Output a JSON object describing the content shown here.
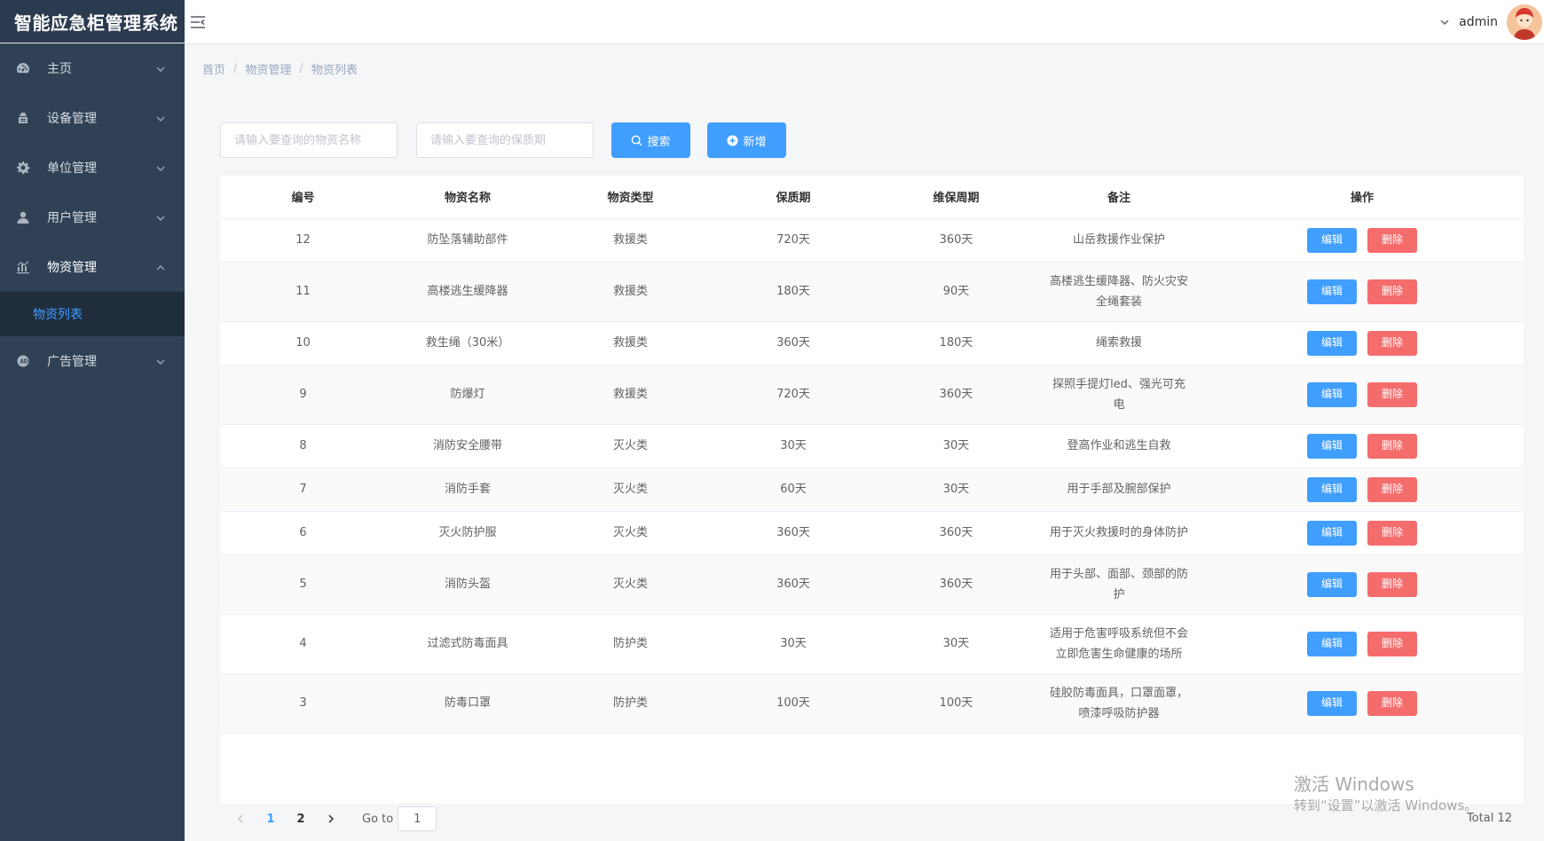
{
  "app": {
    "title": "智能应急柜管理系统"
  },
  "sidebar": {
    "items": [
      {
        "label": "主页",
        "icon": "dashboard-icon"
      },
      {
        "label": "设备管理",
        "icon": "device-icon"
      },
      {
        "label": "单位管理",
        "icon": "gear-icon"
      },
      {
        "label": "用户管理",
        "icon": "user-icon"
      },
      {
        "label": "物资管理",
        "icon": "chart-icon",
        "open": true
      },
      {
        "label": "广告管理",
        "icon": "ad-icon"
      }
    ],
    "submenu": [
      {
        "label": "物资列表",
        "active": true
      }
    ]
  },
  "header": {
    "user": "admin"
  },
  "breadcrumb": [
    "首页",
    "物资管理",
    "物资列表"
  ],
  "toolbar": {
    "name_placeholder": "请输入要查询的物资名称",
    "period_placeholder": "请输入要查询的保质期",
    "search_label": "搜索",
    "add_label": "新增"
  },
  "table": {
    "columns": [
      "编号",
      "物资名称",
      "物资类型",
      "保质期",
      "维保周期",
      "备注",
      "操作"
    ],
    "edit_label": "编辑",
    "delete_label": "删除",
    "rows": [
      [
        "12",
        "防坠落辅助部件",
        "救援类",
        "720天",
        "360天",
        "山岳救援作业保护"
      ],
      [
        "11",
        "高楼逃生缓降器",
        "救援类",
        "180天",
        "90天",
        "高楼逃生缓降器、防火灾安全绳套装"
      ],
      [
        "10",
        "救生绳（30米）",
        "救援类",
        "360天",
        "180天",
        "绳索救援"
      ],
      [
        "9",
        "防爆灯",
        "救援类",
        "720天",
        "360天",
        "探照手提灯led、强光可充电"
      ],
      [
        "8",
        "消防安全腰带",
        "灭火类",
        "30天",
        "30天",
        "登高作业和逃生自救"
      ],
      [
        "7",
        "消防手套",
        "灭火类",
        "60天",
        "30天",
        "用于手部及腕部保护"
      ],
      [
        "6",
        "灭火防护服",
        "灭火类",
        "360天",
        "360天",
        "用于灭火救援时的身体防护"
      ],
      [
        "5",
        "消防头盔",
        "灭火类",
        "360天",
        "360天",
        "用于头部、面部、颈部的防护"
      ],
      [
        "4",
        "过滤式防毒面具",
        "防护类",
        "30天",
        "30天",
        "适用于危害呼吸系统但不会立即危害生命健康的场所"
      ],
      [
        "3",
        "防毒口罩",
        "防护类",
        "100天",
        "100天",
        "硅胶防毒面具，口罩面罩，喷漆呼吸防护器"
      ]
    ]
  },
  "pagination": {
    "pages": [
      "1",
      "2"
    ],
    "current": "1",
    "goto_label": "Go to",
    "goto_value": "1",
    "total": "Total 12"
  },
  "watermark": {
    "line1": "激活 Windows",
    "line2": "转到“设置”以激活 Windows。"
  },
  "colors": {
    "primary": "#409eff",
    "danger": "#f56c6c",
    "sidebar": "#304156"
  }
}
